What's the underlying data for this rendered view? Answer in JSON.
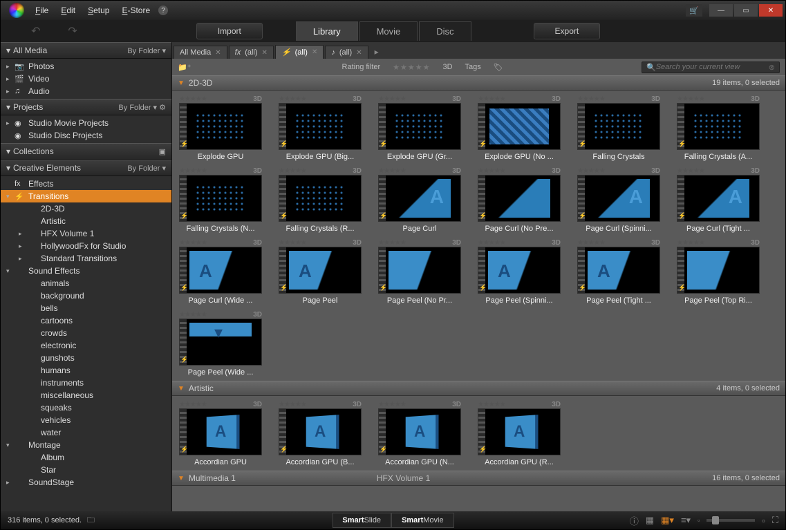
{
  "menu": [
    "File",
    "Edit",
    "Setup",
    "E-Store"
  ],
  "buttons": {
    "import": "Import",
    "export": "Export"
  },
  "mainTabs": {
    "library": "Library",
    "movie": "Movie",
    "disc": "Disc",
    "active": "Library"
  },
  "sidebar": {
    "allMedia": {
      "title": "All Media",
      "sort": "By Folder",
      "items": [
        "Photos",
        "Video",
        "Audio"
      ]
    },
    "projects": {
      "title": "Projects",
      "sort": "By Folder",
      "items": [
        "Studio Movie Projects",
        "Studio Disc Projects"
      ]
    },
    "collections": {
      "title": "Collections"
    },
    "creative": {
      "title": "Creative Elements",
      "sort": "By Folder",
      "effects": "Effects",
      "transitions": "Transitions",
      "transChildren": [
        "2D-3D",
        "Artistic",
        "HFX Volume 1",
        "HollywoodFx for Studio",
        "Standard Transitions"
      ],
      "soundEffects": "Sound Effects",
      "sounds": [
        "animals",
        "background",
        "bells",
        "cartoons",
        "crowds",
        "electronic",
        "gunshots",
        "humans",
        "instruments",
        "miscellaneous",
        "squeaks",
        "vehicles",
        "water"
      ],
      "montage": "Montage",
      "montageChildren": [
        "Album",
        "Star"
      ],
      "soundstage": "SoundStage"
    }
  },
  "filterTabs": [
    {
      "label": "All Media",
      "icon": ""
    },
    {
      "label": "(all)",
      "icon": "fx"
    },
    {
      "label": "(all)",
      "icon": "⚡",
      "active": true
    },
    {
      "label": "(all)",
      "icon": "♪"
    }
  ],
  "filterbar": {
    "rating": "Rating filter",
    "threeD": "3D",
    "tags": "Tags",
    "searchPlaceholder": "Search your current view"
  },
  "groups": [
    {
      "name": "2D-3D",
      "count": "19 items, 0 selected",
      "items": [
        {
          "l": "Explode GPU",
          "a": "explode"
        },
        {
          "l": "Explode GPU (Big...",
          "a": "explode"
        },
        {
          "l": "Explode GPU (Gr...",
          "a": "explode"
        },
        {
          "l": "Explode GPU (No ...",
          "a": "mosaic"
        },
        {
          "l": "Falling Crystals",
          "a": "crystals"
        },
        {
          "l": "Falling Crystals (A...",
          "a": "crystals"
        },
        {
          "l": "Falling Crystals (N...",
          "a": "crystals"
        },
        {
          "l": "Falling Crystals (R...",
          "a": "crystals"
        },
        {
          "l": "Page Curl",
          "a": "curl letter"
        },
        {
          "l": "Page Curl (No Pre...",
          "a": "curl"
        },
        {
          "l": "Page Curl (Spinni...",
          "a": "curl letter"
        },
        {
          "l": "Page Curl (Tight ...",
          "a": "curl letter"
        },
        {
          "l": "Page Curl (Wide ...",
          "a": "peel letter"
        },
        {
          "l": "Page Peel",
          "a": "peel letter"
        },
        {
          "l": "Page Peel (No Pr...",
          "a": "peel"
        },
        {
          "l": "Page Peel (Spinni...",
          "a": "peel letter"
        },
        {
          "l": "Page Peel (Tight ...",
          "a": "peel letter"
        },
        {
          "l": "Page Peel (Top Ri...",
          "a": "peel"
        },
        {
          "l": "Page Peel (Wide ...",
          "a": "peelwide"
        }
      ]
    },
    {
      "name": "Artistic",
      "count": "4 items, 0 selected",
      "items": [
        {
          "l": "Accordian GPU",
          "a": "cube"
        },
        {
          "l": "Accordian GPU (B...",
          "a": "cube"
        },
        {
          "l": "Accordian GPU (N...",
          "a": "cube"
        },
        {
          "l": "Accordian GPU (R...",
          "a": "cube"
        }
      ]
    },
    {
      "name": "Multimedia 1",
      "count": "16 items, 0 selected",
      "sub": "HFX Volume 1",
      "items": []
    }
  ],
  "footer": {
    "status": "316 items, 0 selected.",
    "smartslide": "SmartSlide",
    "smartmovie": "SmartMovie"
  }
}
